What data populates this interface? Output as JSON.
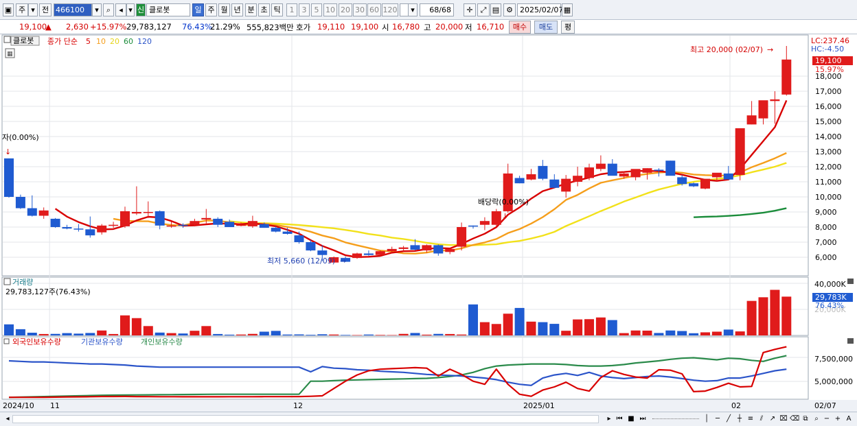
{
  "toolbar": {
    "market": "주",
    "prev_label": "전",
    "stock_code": "466100",
    "new_badge": "신",
    "stock_name": "클로봇",
    "periods": [
      "일",
      "주",
      "월",
      "년",
      "분",
      "초",
      "틱"
    ],
    "period_selected": "일",
    "intervals": [
      "1",
      "3",
      "5",
      "10",
      "20",
      "30",
      "60",
      "120"
    ],
    "count_display": "68/68",
    "date": "2025/02/07"
  },
  "quote": {
    "price": "19,100",
    "change_arrow": "▲",
    "change": "2,630",
    "change_pct": "+15.97%",
    "volume": "29,783,127",
    "turnover_pct": "76.43%",
    "other_pct": "21.29%",
    "amount": "555,823백만",
    "ask_label": "호가",
    "ask1": "19,110",
    "ask2": "19,100",
    "open_label": "시",
    "open": "16,780",
    "high_label": "고",
    "high": "20,000",
    "low_label": "저",
    "low": "16,710",
    "buy_label": "매수",
    "sell_label": "매도",
    "avg_label": "평"
  },
  "price_panel": {
    "name_tag": "클로봇",
    "ma_label": "종가 단순",
    "ma_periods": [
      "5",
      "10",
      "20",
      "60",
      "120"
    ],
    "ma_colors": [
      "#d80000",
      "#f59e1b",
      "#f2e11a",
      "#1a8c3a",
      "#2b54c9"
    ],
    "lc_label": "LC:237.46",
    "hc_label": "HC:-4.50",
    "current_price_tag": "19,100",
    "current_pct_tag": "15.97%",
    "annotation_high": "최고 20,000 (02/07)",
    "annotation_low": "최저 5,660 (12/09)",
    "annotation_dividend": "배당락(0.00%)",
    "annotation_left": "자(0.00%)"
  },
  "volume_panel": {
    "title": "거래량",
    "value_label": "29,783,127주(76.43%)",
    "axis_top": "40,000K",
    "axis_hidden": "20,000K",
    "current_tag": "29,783K",
    "current_pct": "76.43%"
  },
  "holdings_panel": {
    "legend": [
      "외국인보유수량",
      "기관보유수량",
      "개인보유수량"
    ],
    "colors": [
      "#d80000",
      "#2b54c9",
      "#2a8a4a"
    ]
  },
  "xaxis": {
    "labels": [
      "2024/10",
      "11",
      "12",
      "2025/01",
      "02"
    ],
    "last_date": "02/07"
  },
  "colors": {
    "up": "#e01b1b",
    "down": "#1f5bd1"
  },
  "chart_data": {
    "type": "candlestick",
    "symbol": "클로봇",
    "code": "466100",
    "y_ticks": [
      6000,
      7000,
      8000,
      9000,
      10000,
      11000,
      12000,
      13000,
      14000,
      15000,
      16000,
      17000,
      18000
    ],
    "ohlc": [
      [
        12550,
        12550,
        9950,
        10000
      ],
      [
        10000,
        10150,
        9200,
        9250
      ],
      [
        9250,
        10100,
        8700,
        8750
      ],
      [
        8750,
        9300,
        8550,
        9100
      ],
      [
        8550,
        8600,
        7950,
        8000
      ],
      [
        8000,
        8150,
        7850,
        7900
      ],
      [
        7900,
        8200,
        7700,
        7850
      ],
      [
        7850,
        8700,
        7300,
        7450
      ],
      [
        7650,
        8200,
        7500,
        8100
      ],
      [
        8150,
        8350,
        7950,
        8150
      ],
      [
        8050,
        9350,
        7950,
        9050
      ],
      [
        8900,
        10700,
        8800,
        9000
      ],
      [
        9000,
        9700,
        8600,
        9000
      ],
      [
        9050,
        9100,
        7850,
        8100
      ],
      [
        8050,
        8350,
        7950,
        8100
      ],
      [
        8150,
        8250,
        7950,
        8100
      ],
      [
        8150,
        8550,
        8050,
        8400
      ],
      [
        8500,
        9200,
        8250,
        8600
      ],
      [
        8550,
        8650,
        8000,
        8150
      ],
      [
        8350,
        8500,
        8000,
        8000
      ],
      [
        8100,
        8300,
        8050,
        8150
      ],
      [
        8050,
        8750,
        7950,
        8400
      ],
      [
        8200,
        8300,
        7950,
        7950
      ],
      [
        7950,
        8050,
        7650,
        7700
      ],
      [
        7700,
        7950,
        7500,
        7550
      ],
      [
        7450,
        7700,
        6900,
        7000
      ],
      [
        7000,
        7150,
        6400,
        6450
      ],
      [
        6450,
        6800,
        5750,
        6150
      ],
      [
        5650,
        6050,
        5660,
        6000
      ],
      [
        5950,
        6050,
        5700,
        5700
      ],
      [
        5950,
        6300,
        5900,
        6250
      ],
      [
        6250,
        6450,
        6100,
        6150
      ],
      [
        6150,
        6450,
        6050,
        6400
      ],
      [
        6400,
        6700,
        6250,
        6550
      ],
      [
        6550,
        6750,
        6400,
        6650
      ],
      [
        6800,
        7200,
        6450,
        6500
      ],
      [
        6450,
        6850,
        6300,
        6800
      ],
      [
        6800,
        6850,
        6100,
        6250
      ],
      [
        6350,
        6600,
        6200,
        6550
      ],
      [
        6700,
        8300,
        6450,
        8000
      ],
      [
        8100,
        8100,
        7900,
        8050
      ],
      [
        8150,
        8650,
        7800,
        8400
      ],
      [
        8150,
        9200,
        8050,
        9050
      ],
      [
        9050,
        12200,
        8950,
        11550
      ],
      [
        11250,
        11400,
        10900,
        10900
      ],
      [
        11150,
        11850,
        11100,
        11500
      ],
      [
        12050,
        12450,
        11100,
        11200
      ],
      [
        11150,
        11500,
        10600,
        10600
      ],
      [
        10350,
        11450,
        9950,
        11200
      ],
      [
        11000,
        12000,
        10700,
        11400
      ],
      [
        11250,
        12200,
        11100,
        11950
      ],
      [
        11850,
        12750,
        11700,
        12200
      ],
      [
        12200,
        12500,
        11550,
        11400
      ],
      [
        11350,
        11700,
        11200,
        11550
      ],
      [
        11300,
        11650,
        11100,
        11850
      ],
      [
        11600,
        11900,
        11150,
        11900
      ],
      [
        11800,
        11900,
        11350,
        11750
      ],
      [
        12400,
        12400,
        11550,
        11400
      ],
      [
        11300,
        11450,
        10750,
        10850
      ],
      [
        10900,
        10950,
        10650,
        10700
      ],
      [
        10550,
        11150,
        10500,
        11200
      ],
      [
        11300,
        11450,
        11050,
        11600
      ],
      [
        11550,
        12050,
        11150,
        11150
      ],
      [
        11450,
        12000,
        11100,
        14550
      ],
      [
        14800,
        16350,
        14800,
        15400
      ],
      [
        15200,
        15600,
        14800,
        16400
      ],
      [
        16350,
        17000,
        14850,
        16460
      ],
      [
        16780,
        20000,
        16710,
        19100
      ]
    ],
    "ma5": [
      null,
      null,
      null,
      null,
      9220,
      8690,
      8330,
      8050,
      7840,
      7870,
      8100,
      8440,
      8680,
      8630,
      8400,
      8090,
      8110,
      8180,
      8240,
      8220,
      8190,
      8250,
      8170,
      8050,
      7820,
      7560,
      7130,
      6750,
      6460,
      6130,
      6010,
      6030,
      6090,
      6300,
      6400,
      6420,
      6550,
      6620,
      6580,
      6880,
      7240,
      7560,
      7990,
      8820,
      9300,
      9880,
      10380,
      10620,
      10880,
      11080,
      11280,
      11500,
      11610,
      11650,
      11720,
      11720,
      11710,
      11620,
      11470,
      11290,
      11130,
      11060,
      11150,
      11860,
      12780,
      13700,
      14620,
      16390
    ],
    "ma10": [
      null,
      null,
      null,
      null,
      null,
      null,
      null,
      null,
      null,
      8550,
      8410,
      8390,
      8380,
      8230,
      8130,
      8100,
      8280,
      8430,
      8430,
      8310,
      8130,
      8170,
      8220,
      8140,
      8010,
      7880,
      7690,
      7440,
      7260,
      6980,
      6790,
      6620,
      6440,
      6380,
      6260,
      6240,
      6310,
      6450,
      6440,
      6590,
      6820,
      6980,
      7210,
      7600,
      7870,
      8230,
      8660,
      9180,
      9800,
      10130,
      10560,
      10930,
      11100,
      11250,
      11410,
      11520,
      11610,
      11660,
      11600,
      11480,
      11440,
      11420,
      11410,
      11610,
      11970,
      12250,
      12560,
      12910
    ],
    "ma20": [
      null,
      null,
      null,
      null,
      null,
      null,
      null,
      null,
      null,
      null,
      null,
      null,
      null,
      null,
      null,
      null,
      null,
      null,
      null,
      8380,
      8310,
      8250,
      8260,
      8230,
      8180,
      8130,
      8070,
      7990,
      7920,
      7810,
      7690,
      7540,
      7440,
      7300,
      7210,
      7090,
      6960,
      6860,
      6810,
      6810,
      6790,
      6830,
      6860,
      6990,
      7080,
      7240,
      7430,
      7680,
      8070,
      8390,
      8720,
      9060,
      9370,
      9690,
      9960,
      10240,
      10490,
      10680,
      10870,
      11000,
      11100,
      11190,
      11280,
      11430,
      11630,
      11810,
      12000,
      12250
    ],
    "ma60": [
      null,
      null,
      null,
      null,
      null,
      null,
      null,
      null,
      null,
      null,
      null,
      null,
      null,
      null,
      null,
      null,
      null,
      null,
      null,
      null,
      null,
      null,
      null,
      null,
      null,
      null,
      null,
      null,
      null,
      null,
      null,
      null,
      null,
      null,
      null,
      null,
      null,
      null,
      null,
      null,
      null,
      null,
      null,
      null,
      null,
      null,
      null,
      null,
      null,
      null,
      null,
      null,
      null,
      null,
      null,
      null,
      null,
      null,
      null,
      8650,
      8680,
      8700,
      8740,
      8790,
      8870,
      8950,
      9080,
      9250
    ],
    "volume_k": [
      8500,
      4800,
      2100,
      1100,
      1200,
      1800,
      1400,
      1900,
      3800,
      1100,
      15400,
      13300,
      7200,
      2200,
      1800,
      1500,
      3600,
      7200,
      1100,
      600,
      700,
      1200,
      2900,
      3500,
      700,
      800,
      500,
      900,
      700,
      400,
      300,
      700,
      400,
      300,
      1200,
      1900,
      600,
      1200,
      1100,
      700,
      23800,
      10200,
      8800,
      16700,
      21100,
      10600,
      10200,
      8900,
      3600,
      12300,
      12500,
      13800,
      11800,
      1800,
      3800,
      3700,
      1900,
      3800,
      3400,
      1700,
      2400,
      2900,
      4500,
      3100,
      26500,
      29300,
      35000,
      29783
    ],
    "holdings": {
      "foreign": [
        100,
        100,
        110,
        120,
        150,
        180,
        200,
        230,
        260,
        260,
        270,
        250,
        240,
        230,
        220,
        210,
        210,
        210,
        210,
        220,
        230,
        230,
        240,
        240,
        240,
        250,
        300,
        400,
        1800,
        3200,
        4400,
        5200,
        5500,
        5600,
        5700,
        5800,
        5700,
        4200,
        5500,
        4500,
        3200,
        2600,
        5500,
        2600,
        700,
        300,
        1500,
        2100,
        3000,
        1800,
        1300,
        3900,
        5200,
        4500,
        4000,
        3800,
        5400,
        5300,
        4600,
        1200,
        1300,
        2000,
        2800,
        2100,
        2200,
        8700,
        9300,
        9800
      ],
      "institution": [
        7100,
        7000,
        6900,
        6900,
        6800,
        6700,
        6600,
        6500,
        6500,
        6400,
        6300,
        6100,
        6000,
        5900,
        5900,
        5900,
        5900,
        5900,
        5900,
        5900,
        5900,
        5900,
        5900,
        5900,
        5900,
        5900,
        5000,
        6000,
        5700,
        5600,
        5400,
        5300,
        5100,
        5000,
        4900,
        4700,
        4500,
        4400,
        4300,
        4200,
        4000,
        3800,
        3500,
        3000,
        2600,
        2400,
        3800,
        4400,
        4700,
        4300,
        4900,
        4200,
        3900,
        3700,
        3900,
        4100,
        4200,
        4000,
        3700,
        3400,
        3200,
        3300,
        3800,
        3800,
        4200,
        4700,
        5200,
        5500
      ],
      "individual": [
        100,
        150,
        200,
        250,
        300,
        350,
        400,
        450,
        500,
        520,
        540,
        560,
        580,
        600,
        620,
        640,
        660,
        680,
        700,
        700,
        700,
        700,
        700,
        700,
        700,
        700,
        3200,
        3200,
        3300,
        3400,
        3450,
        3500,
        3550,
        3600,
        3650,
        3700,
        3750,
        3900,
        4100,
        4400,
        4900,
        5600,
        6100,
        6300,
        6400,
        6500,
        6500,
        6500,
        6400,
        6200,
        6100,
        6100,
        6200,
        6400,
        6700,
        6900,
        7100,
        7400,
        7600,
        7700,
        7500,
        7300,
        7600,
        7500,
        7200,
        7000,
        7600,
        8100
      ]
    },
    "holdings_axis": [
      "7,500,000",
      "5,000,000"
    ]
  }
}
